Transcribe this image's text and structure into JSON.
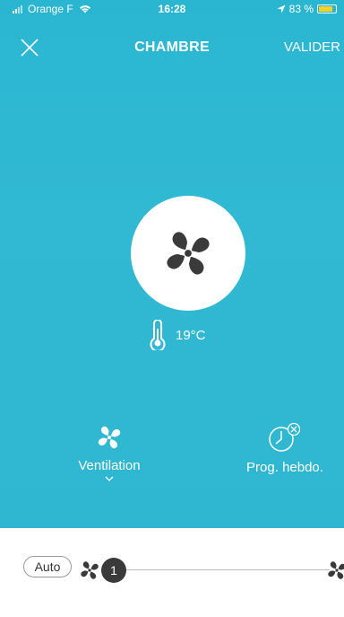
{
  "status_bar": {
    "carrier": "Orange F",
    "time": "16:28",
    "battery_percent": "83 %",
    "battery_level": 0.83
  },
  "nav": {
    "title": "CHAMBRE",
    "validate_label": "VALIDER"
  },
  "temperature": {
    "value": "19°C"
  },
  "modes": {
    "ventilation_label": "Ventilation",
    "prog_label": "Prog. hebdo."
  },
  "slider": {
    "auto_label": "Auto",
    "current_value": "1"
  },
  "colors": {
    "accent": "#2fb7d2",
    "fan_icon": "#3a3a3a",
    "battery": "#f2d12b"
  },
  "icons": {
    "close": "close-icon",
    "fan": "fan-icon",
    "thermometer": "thermometer-icon",
    "clock_cancel": "clock-cancel-icon",
    "chevron": "chevron-down-icon"
  }
}
